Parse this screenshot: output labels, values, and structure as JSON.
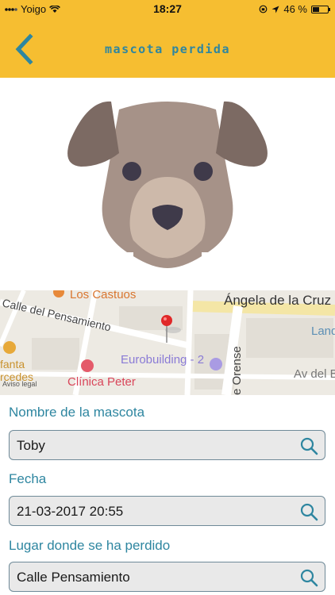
{
  "status_bar": {
    "carrier": "Yoigo",
    "time": "18:27",
    "battery": "46 %",
    "battery_level": 0.46
  },
  "nav": {
    "title": "mascota perdida",
    "back_icon": "chevron-left-icon"
  },
  "hero": {
    "icon": "dog-face-icon"
  },
  "map": {
    "labels": {
      "los_castuos": "Los Castuos",
      "angela_de_la_cruz": "Ángela de la Cruz",
      "calle_del_pensamiento": "Calle del Pensamiento",
      "eurobuilding": "Eurobuilding - 2",
      "clinica": "Clínica Peter",
      "infanta": "fanta",
      "mercedes": "rcedes",
      "av": "Av del B",
      "land": "Land",
      "orense": "e Orense",
      "legal": "Aviso legal"
    },
    "pin_icon": "map-pin-icon"
  },
  "form": {
    "fields": [
      {
        "label": "Nombre de la mascota",
        "value": "Toby",
        "icon": "search-icon"
      },
      {
        "label": "Fecha",
        "value": "21-03-2017 20:55",
        "icon": "search-icon"
      },
      {
        "label": "Lugar donde se ha perdido",
        "value": "Calle Pensamiento",
        "icon": "search-icon"
      }
    ]
  },
  "colors": {
    "header": "#F6BE31",
    "accent": "#2E86A0",
    "field_bg": "#E9E9E9"
  }
}
